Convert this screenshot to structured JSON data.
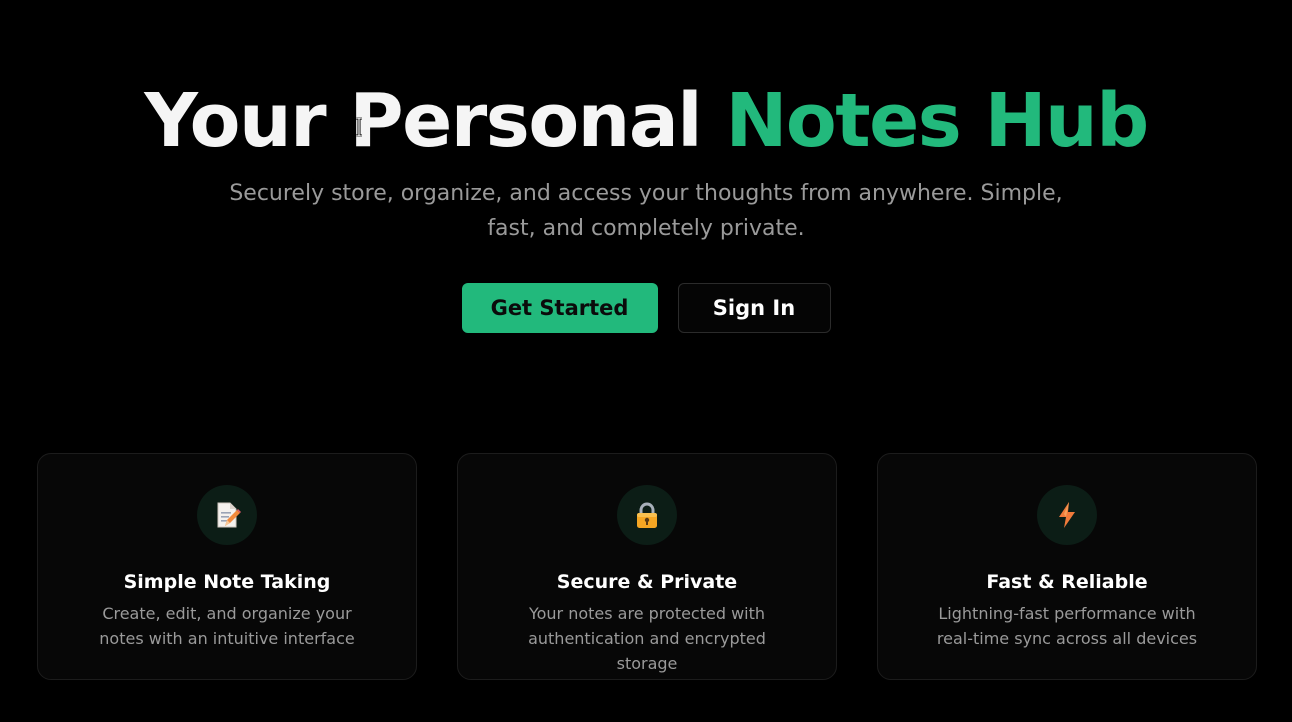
{
  "hero": {
    "title_main": "Your Personal ",
    "title_accent": "Notes Hub",
    "subtitle": "Securely store, organize, and access your thoughts from anywhere. Simple, fast, and completely private."
  },
  "cta": {
    "primary_label": "Get Started",
    "secondary_label": "Sign In"
  },
  "features": [
    {
      "icon": "memo-pencil-icon",
      "title": "Simple Note Taking",
      "description": "Create, edit, and organize your notes with an intuitive interface"
    },
    {
      "icon": "lock-icon",
      "title": "Secure & Private",
      "description": "Your notes are protected with authentication and encrypted storage"
    },
    {
      "icon": "lightning-icon",
      "title": "Fast & Reliable",
      "description": "Lightning-fast performance with real-time sync across all devices"
    }
  ],
  "colors": {
    "background": "#000000",
    "accent": "#22b97c",
    "muted_text": "#9a9a9a",
    "card_background": "#070707"
  }
}
